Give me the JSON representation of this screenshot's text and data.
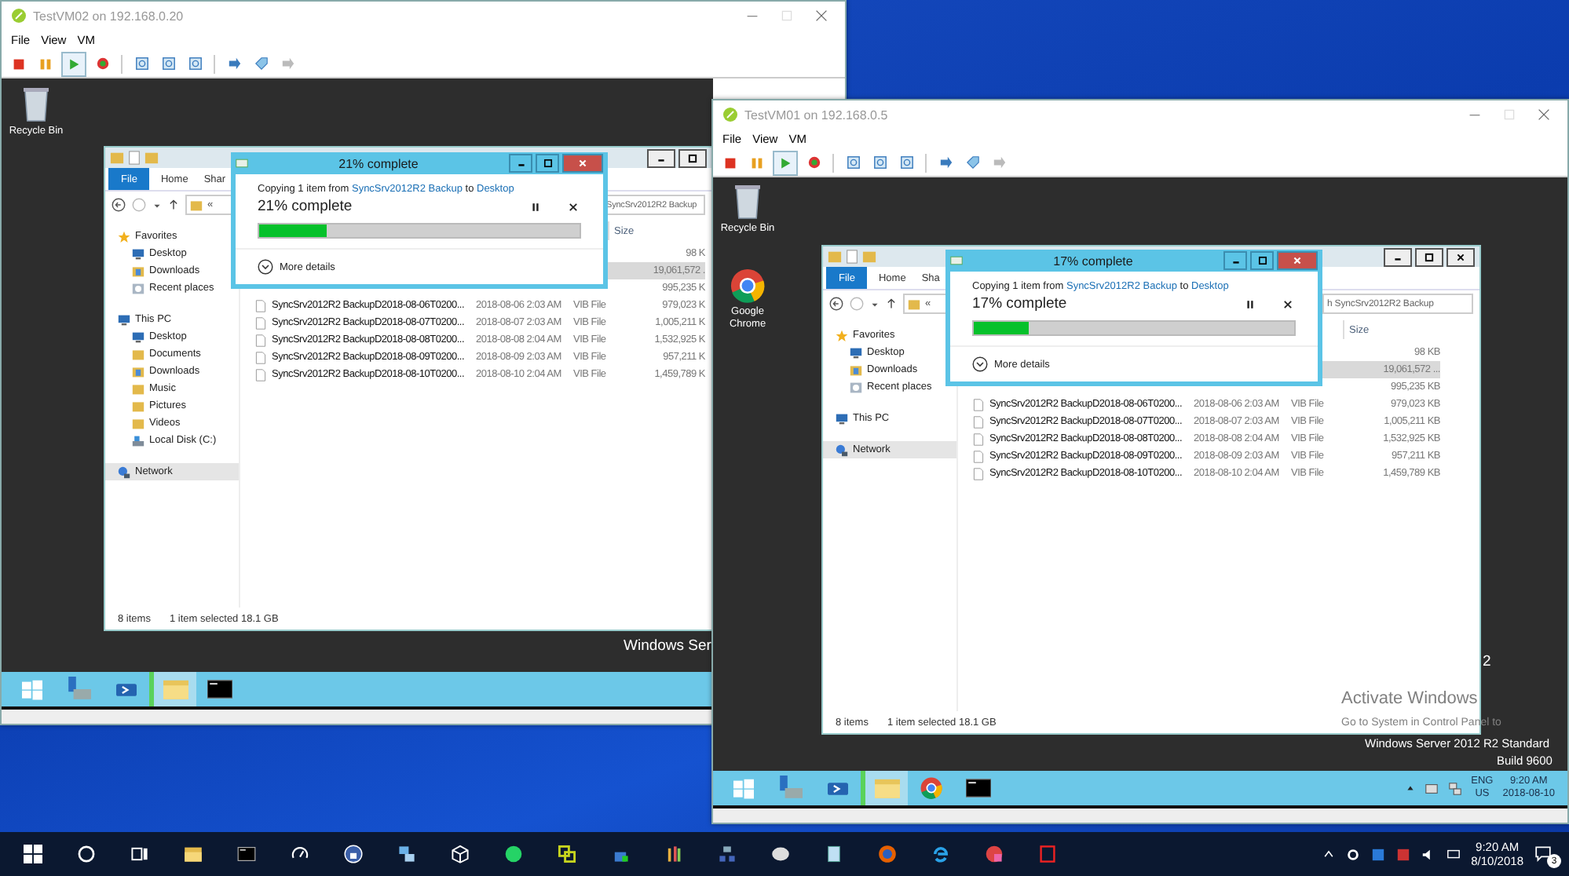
{
  "vms": [
    {
      "title": "TestVM02 on 192.168.0.20",
      "menu": [
        "File",
        "View",
        "VM"
      ],
      "desktop_icons": [
        {
          "kind": "recycle-bin",
          "label": "Recycle Bin"
        }
      ],
      "explorer": {
        "ribbon_tabs": [
          {
            "kind": "file",
            "label": "File"
          },
          {
            "kind": "tab",
            "label": "Home"
          },
          {
            "kind": "tab",
            "label": "Shar"
          }
        ],
        "address": "«",
        "search_placeholder": "SyncSrv2012R2 Backup",
        "nav": [
          {
            "kind": "favorites",
            "label": "Favorites",
            "selected": false,
            "children": [
              {
                "kind": "desktop",
                "label": "Desktop",
                "selected": false
              },
              {
                "kind": "downloads",
                "label": "Downloads",
                "selected": false
              },
              {
                "kind": "recent",
                "label": "Recent places",
                "selected": false
              }
            ]
          },
          {
            "kind": "pc",
            "label": "This PC",
            "selected": false,
            "children": [
              {
                "kind": "desktop",
                "label": "Desktop",
                "selected": false
              },
              {
                "kind": "folder",
                "label": "Documents",
                "selected": false
              },
              {
                "kind": "downloads",
                "label": "Downloads",
                "selected": false
              },
              {
                "kind": "folder",
                "label": "Music",
                "selected": false
              },
              {
                "kind": "folder",
                "label": "Pictures",
                "selected": false
              },
              {
                "kind": "folder",
                "label": "Videos",
                "selected": false
              },
              {
                "kind": "drive",
                "label": "Local Disk (C:)",
                "selected": false
              }
            ]
          },
          {
            "kind": "network",
            "label": "Network",
            "selected": true
          }
        ],
        "size_column": "Size",
        "rows": [
          {
            "size": "98 K",
            "selected": false
          },
          {
            "size": "19,061,572 .",
            "selected": true
          },
          {
            "size": "995,235 K",
            "selected": false
          },
          {
            "name": "SyncSrv2012R2 BackupD2018-08-06T0200...",
            "date": "2018-08-06 2:03 AM",
            "type": "VIB File",
            "size": "979,023 K",
            "selected": false
          },
          {
            "name": "SyncSrv2012R2 BackupD2018-08-07T0200...",
            "date": "2018-08-07 2:03 AM",
            "type": "VIB File",
            "size": "1,005,211 K",
            "selected": false
          },
          {
            "name": "SyncSrv2012R2 BackupD2018-08-08T0200...",
            "date": "2018-08-08 2:04 AM",
            "type": "VIB File",
            "size": "1,532,925 K",
            "selected": false
          },
          {
            "name": "SyncSrv2012R2 BackupD2018-08-09T0200...",
            "date": "2018-08-09 2:03 AM",
            "type": "VIB File",
            "size": "957,211 K",
            "selected": false
          },
          {
            "name": "SyncSrv2012R2 BackupD2018-08-10T0200...",
            "date": "2018-08-10 2:04 AM",
            "type": "VIB File",
            "size": "1,459,789 K",
            "selected": false
          }
        ],
        "items_count": "8 items",
        "selection": "1 item selected 18.1 GB"
      },
      "copy_dialog": {
        "title": "21% complete",
        "prefix": "Copying 1 item from",
        "source": "SyncSrv2012R2 Backup",
        "middle": "to",
        "destination": "Desktop",
        "status": "21% complete",
        "level": 0.21,
        "details": "More details"
      },
      "desktop_texts": [
        {
          "kind": "large",
          "text": "Windows Ser"
        }
      ],
      "taskbar": {
        "apps": [
          {
            "kind": "start",
            "active": false
          },
          {
            "kind": "server-manager",
            "active": false
          },
          {
            "kind": "powershell",
            "active": false
          },
          {
            "kind": "explorer",
            "active": true
          },
          {
            "kind": "cmd",
            "active": false
          }
        ]
      }
    },
    {
      "title": "TestVM01 on 192.168.0.5",
      "menu": [
        "File",
        "View",
        "VM"
      ],
      "desktop_icons": [
        {
          "kind": "recycle-bin",
          "label": "Recycle Bin"
        },
        {
          "kind": "chrome",
          "label": "Google Chrome"
        }
      ],
      "explorer": {
        "ribbon_tabs": [
          {
            "kind": "file",
            "label": "File"
          },
          {
            "kind": "tab",
            "label": "Home"
          },
          {
            "kind": "tab",
            "label": "Sha"
          }
        ],
        "address": "«",
        "search_placeholder": "h SyncSrv2012R2 Backup",
        "nav": [
          {
            "kind": "favorites",
            "label": "Favorites",
            "selected": false,
            "children": [
              {
                "kind": "desktop",
                "label": "Desktop",
                "selected": false
              },
              {
                "kind": "downloads",
                "label": "Downloads",
                "selected": false
              },
              {
                "kind": "recent",
                "label": "Recent places",
                "selected": false
              }
            ]
          },
          {
            "kind": "pc",
            "label": "This PC",
            "selected": false
          },
          {
            "kind": "network",
            "label": "Network",
            "selected": true
          }
        ],
        "size_column": "Size",
        "rows": [
          {
            "size": "98 KB",
            "selected": false
          },
          {
            "size": "19,061,572 ...",
            "selected": true
          },
          {
            "size": "995,235 KB",
            "selected": false
          },
          {
            "name": "SyncSrv2012R2 BackupD2018-08-06T0200...",
            "date": "2018-08-06 2:03 AM",
            "type": "VIB File",
            "size": "979,023 KB",
            "selected": false
          },
          {
            "name": "SyncSrv2012R2 BackupD2018-08-07T0200...",
            "date": "2018-08-07 2:03 AM",
            "type": "VIB File",
            "size": "1,005,211 KB",
            "selected": false
          },
          {
            "name": "SyncSrv2012R2 BackupD2018-08-08T0200...",
            "date": "2018-08-08 2:04 AM",
            "type": "VIB File",
            "size": "1,532,925 KB",
            "selected": false
          },
          {
            "name": "SyncSrv2012R2 BackupD2018-08-09T0200...",
            "date": "2018-08-09 2:03 AM",
            "type": "VIB File",
            "size": "957,211 KB",
            "selected": false
          },
          {
            "name": "SyncSrv2012R2 BackupD2018-08-10T0200...",
            "date": "2018-08-10 2:04 AM",
            "type": "VIB File",
            "size": "1,459,789 KB",
            "selected": false
          }
        ],
        "items_count": "8 items",
        "selection": "1 item selected 18.1 GB"
      },
      "copy_dialog": {
        "title": "17% complete",
        "prefix": "Copying 1 item from",
        "source": "SyncSrv2012R2 Backup",
        "middle": "to",
        "destination": "Desktop",
        "status": "17% complete",
        "level": 0.17,
        "details": "More details"
      },
      "desktop_texts": [
        {
          "kind": "large",
          "text": "2"
        },
        {
          "kind": "activation",
          "text": "Activate Windows"
        },
        {
          "kind": "activation-hint",
          "text": "Go to System in Control Panel to"
        },
        {
          "kind": "edition",
          "text": "Windows Server 2012 R2 Standard"
        },
        {
          "kind": "edition",
          "text": "Build 9600"
        }
      ],
      "taskbar": {
        "apps": [
          {
            "kind": "start",
            "active": false
          },
          {
            "kind": "server-manager",
            "active": false
          },
          {
            "kind": "powershell",
            "active": false
          },
          {
            "kind": "explorer",
            "active": true
          },
          {
            "kind": "chrome",
            "active": false
          },
          {
            "kind": "cmd",
            "active": false
          }
        ],
        "tray": {
          "language": "ENG",
          "region": "US",
          "time": "9:20 AM",
          "date": "2018-08-10"
        }
      }
    }
  ],
  "host_taskbar": {
    "time": "9:20 AM",
    "date": "8/10/2018",
    "notifications": "3"
  }
}
